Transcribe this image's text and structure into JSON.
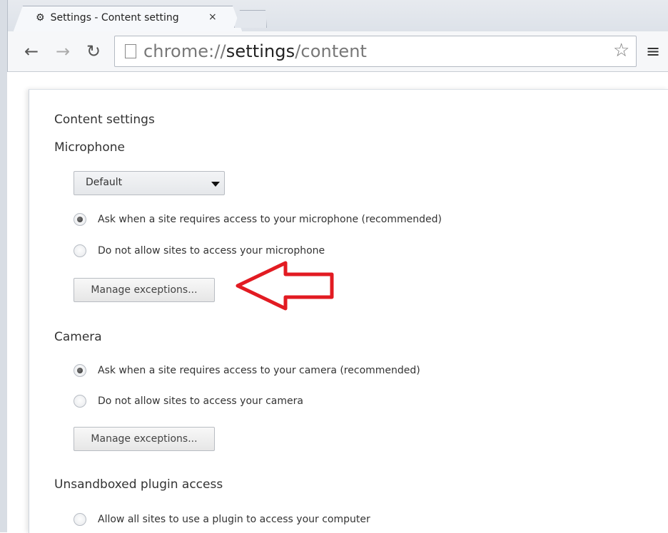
{
  "browser": {
    "tab_title": "Settings - Content setting",
    "tab_close": "×",
    "url_prefix": "chrome://",
    "url_bold": "settings",
    "url_suffix": "/content",
    "icons": {
      "tab": "gear-icon",
      "back": "back-arrow-icon",
      "forward": "forward-arrow-icon",
      "reload": "reload-icon",
      "page": "page-icon",
      "bookmark": "star-icon",
      "menu": "hamburger-menu-icon"
    }
  },
  "settings": {
    "title": "Content settings",
    "microphone": {
      "title": "Microphone",
      "dropdown_value": "Default",
      "options": [
        "Ask when a site requires access to your microphone (recommended)",
        "Do not allow sites to access your microphone"
      ],
      "manage_button": "Manage exceptions..."
    },
    "camera": {
      "title": "Camera",
      "options": [
        "Ask when a site requires access to your camera (recommended)",
        "Do not allow sites to access your camera"
      ],
      "manage_button": "Manage exceptions..."
    },
    "plugins": {
      "title": "Unsandboxed plugin access",
      "options": [
        "Allow all sites to use a plugin to access your computer"
      ]
    }
  },
  "annotation": {
    "arrow_color": "#e21b22"
  }
}
